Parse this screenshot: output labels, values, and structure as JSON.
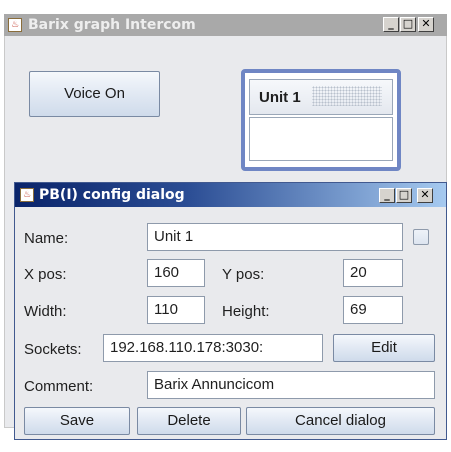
{
  "main_window": {
    "title": "Barix graph Intercom",
    "controls": {
      "minimize": "_",
      "maximize": "□",
      "close": "✕"
    },
    "voice_button_label": "Voice On",
    "unit_panel": {
      "title": "Unit 1"
    }
  },
  "dialog": {
    "title": "PB(I) config dialog",
    "controls": {
      "minimize": "_",
      "maximize": "□",
      "close": "✕"
    },
    "name_label": "Name:",
    "name_value": "Unit 1",
    "xpos_label": "X pos:",
    "xpos_value": "160",
    "ypos_label": "Y pos:",
    "ypos_value": "20",
    "width_label": "Width:",
    "width_value": "110",
    "height_label": "Height:",
    "height_value": "69",
    "sockets_label": "Sockets:",
    "sockets_value": "192.168.110.178:3030:",
    "edit_label": "Edit",
    "comment_label": "Comment:",
    "comment_value": "Barix Annuncicom",
    "save_label": "Save",
    "delete_label": "Delete",
    "cancel_label": "Cancel dialog"
  },
  "icons": {
    "app_icon": "java-cup-icon"
  },
  "colors": {
    "dialog_title_start": "#0a246a",
    "dialog_title_end": "#a6caf0",
    "unit_panel_border": "#6f86c4"
  }
}
